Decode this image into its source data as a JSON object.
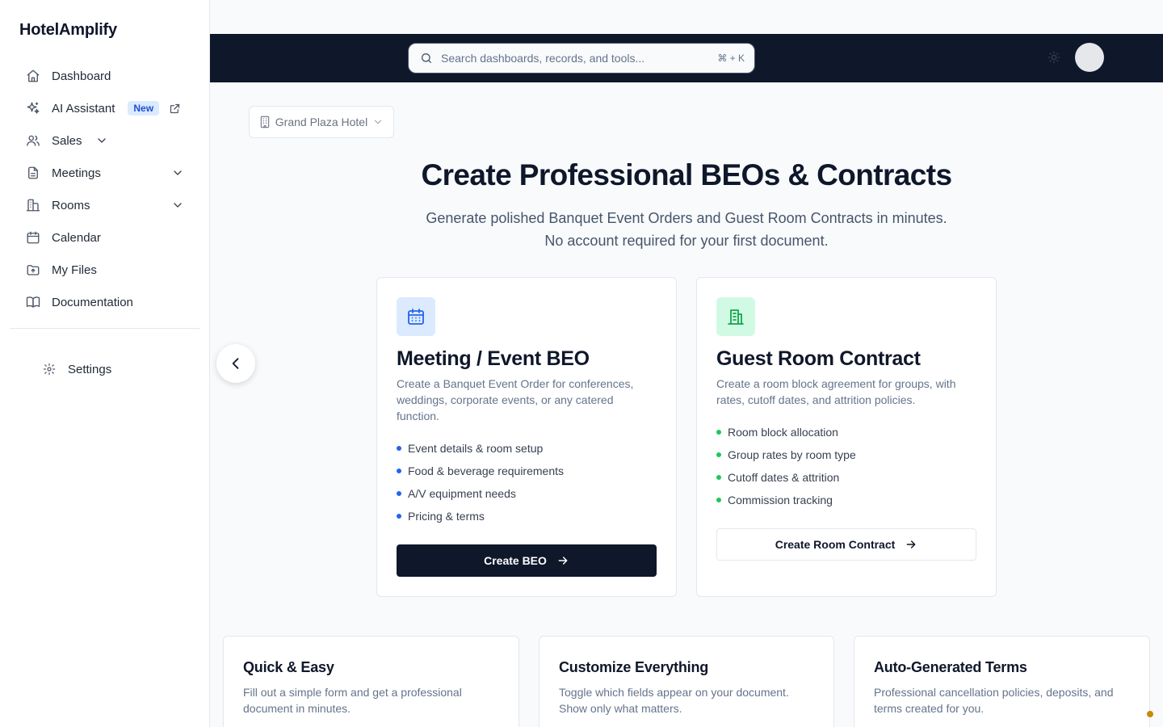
{
  "app": {
    "brand": "HotelAmplify"
  },
  "sidebar": {
    "items": [
      {
        "label": "Dashboard",
        "icon": "home-icon"
      },
      {
        "label": "AI Assistant",
        "icon": "sparkles-icon",
        "badge": "New"
      },
      {
        "label": "Sales",
        "icon": "users-icon"
      },
      {
        "label": "Meetings",
        "icon": "document-icon"
      },
      {
        "label": "Rooms",
        "icon": "building-icon"
      },
      {
        "label": "Calendar",
        "icon": "calendar-icon"
      },
      {
        "label": "My Files",
        "icon": "folder-icon"
      },
      {
        "label": "Documentation",
        "icon": "book-icon"
      }
    ],
    "settings_label": "Settings"
  },
  "header": {
    "search_placeholder": "Search dashboards, records, and tools...",
    "shortcut": "⌘ + K"
  },
  "hotel_selector": {
    "value": "Grand Plaza Hotel"
  },
  "hero": {
    "title": "Create Professional BEOs & Contracts",
    "subtitle_line1": "Generate polished Banquet Event Orders and Guest Room Contracts in minutes.",
    "subtitle_line2": "No account required for your first document."
  },
  "cards": {
    "beo": {
      "title": "Meeting / Event BEO",
      "description": "Create a Banquet Event Order for conferences, weddings, corporate events, or any catered function.",
      "features": [
        "Event details & room setup",
        "Food & beverage requirements",
        "A/V equipment needs",
        "Pricing & terms"
      ],
      "button": "Create BEO",
      "accent": "#2563eb"
    },
    "room": {
      "title": "Guest Room Contract",
      "description": "Create a room block agreement for groups, with rates, cutoff dates, and attrition policies.",
      "features": [
        "Room block allocation",
        "Group rates by room type",
        "Cutoff dates & attrition",
        "Commission tracking"
      ],
      "button": "Create Room Contract",
      "accent": "#22c55e"
    }
  },
  "features": [
    {
      "title": "Quick & Easy",
      "text": "Fill out a simple form and get a professional document in minutes."
    },
    {
      "title": "Customize Everything",
      "text": "Toggle which fields appear on your document. Show only what matters."
    },
    {
      "title": "Auto-Generated Terms",
      "text": "Professional cancellation policies, deposits, and terms created for you."
    }
  ]
}
